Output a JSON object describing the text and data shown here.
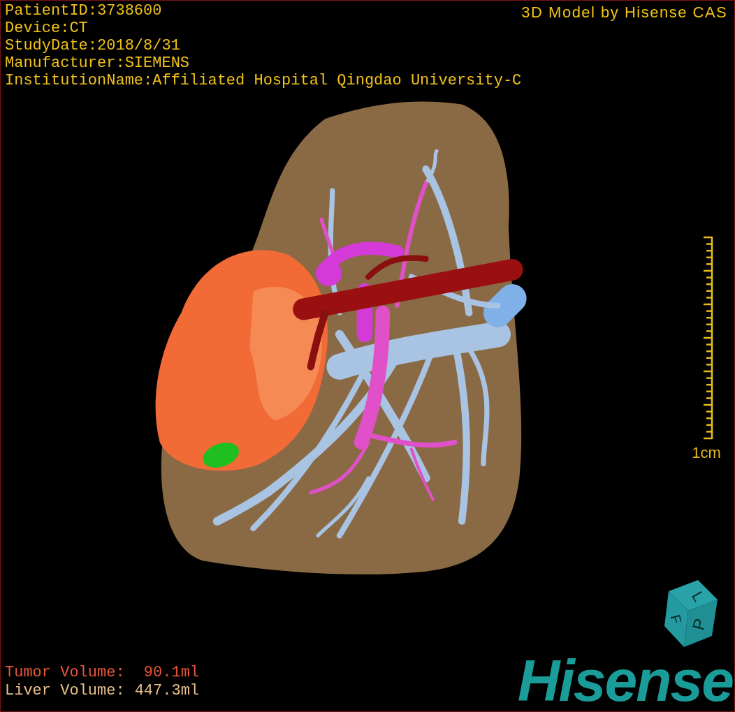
{
  "header": {
    "info": [
      "PatientID:3738600",
      "Device:CT",
      "StudyDate:2018/8/31",
      "Manufacturer:SIEMENS",
      "InstitutionName:Affiliated Hospital Qingdao University-C"
    ],
    "title": "3D Model by Hisense CAS"
  },
  "scale_bar": {
    "label": "1cm"
  },
  "volumes": [
    {
      "kind": "tumor",
      "label": "Tumor Volume:",
      "value": "90.1ml"
    },
    {
      "kind": "liver",
      "label": "Liver Volume:",
      "value": "447.3ml"
    }
  ],
  "orientation_cube": {
    "faces": [
      "L",
      "P",
      "F"
    ]
  },
  "logo": "Hisense"
}
